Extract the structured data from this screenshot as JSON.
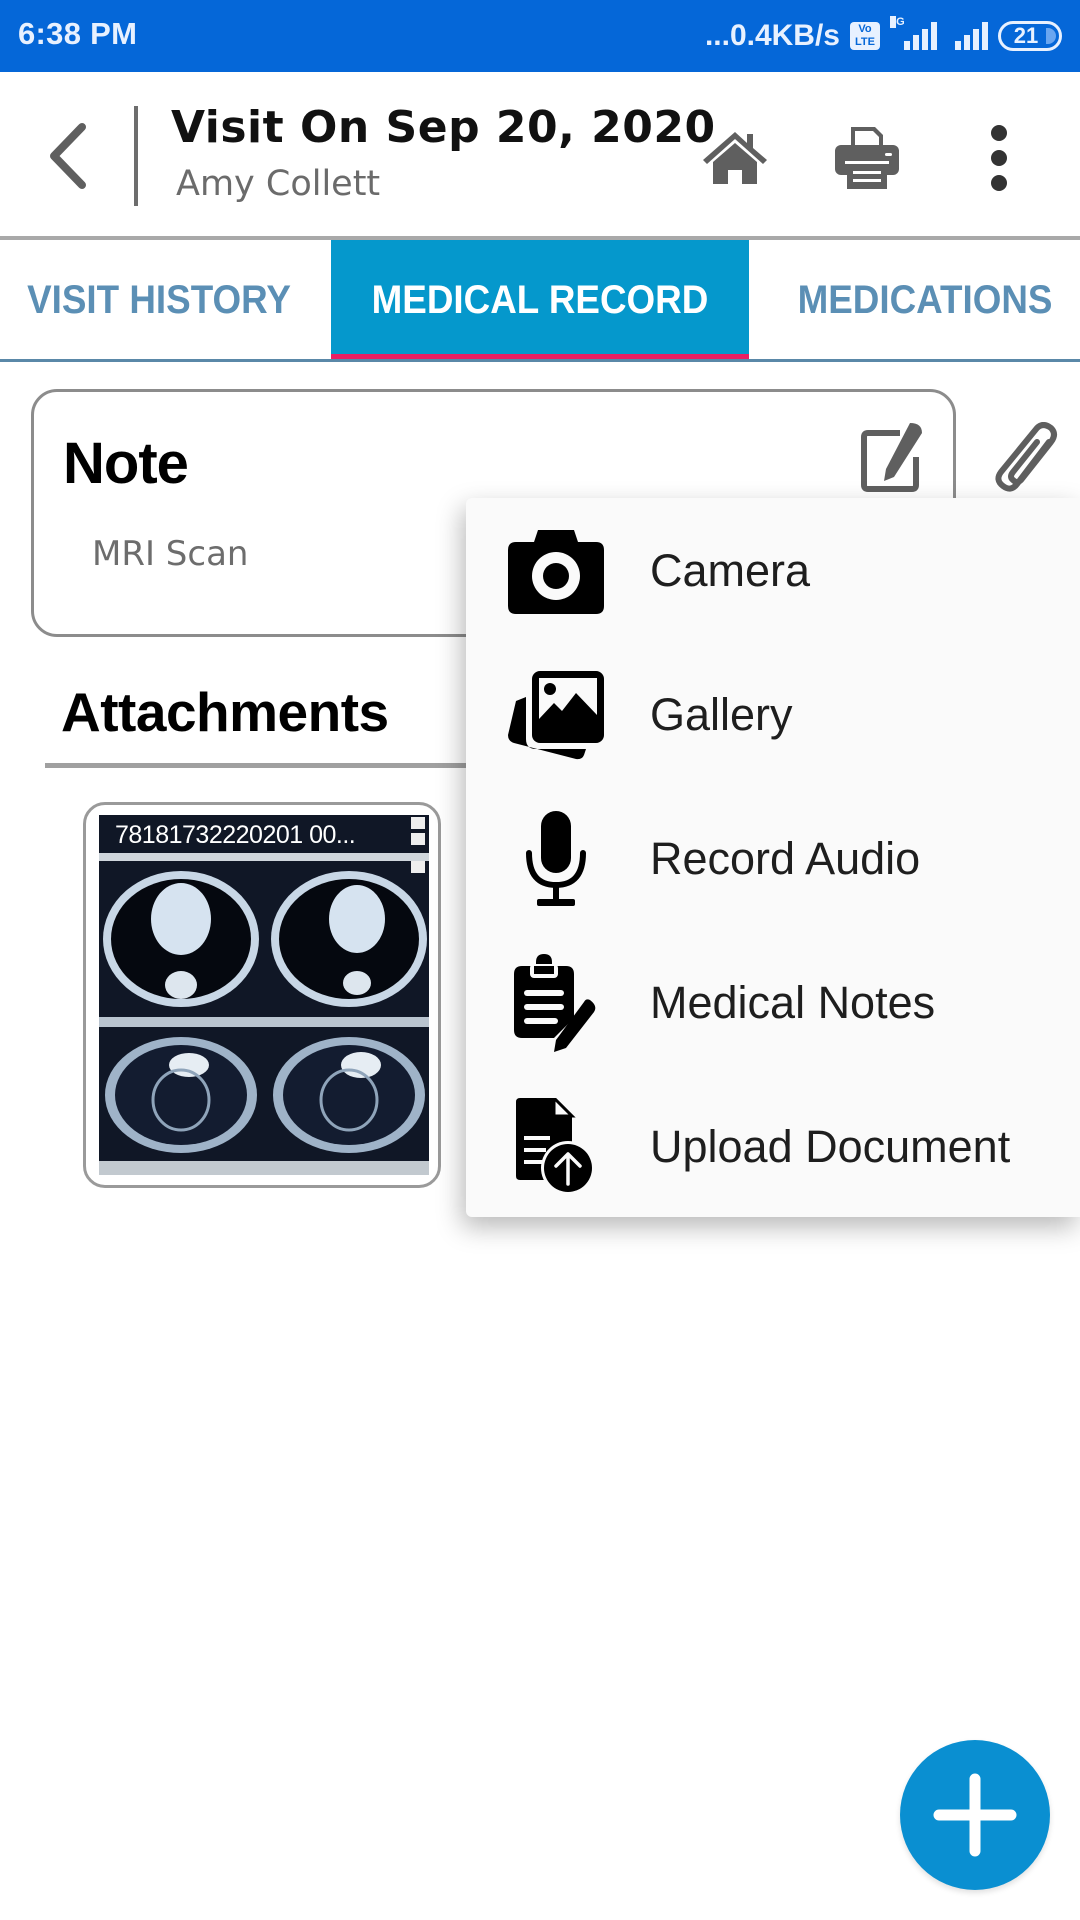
{
  "status_bar": {
    "time": "6:38 PM",
    "network_speed": "...0.4KB/s",
    "volte_badge": "Vo\nLTE",
    "network_type": "4G",
    "battery_level": "21"
  },
  "header": {
    "back_icon": "chevron-left-icon",
    "title": "Visit On Sep 20, 2020",
    "subtitle": "Amy Collett",
    "actions": [
      {
        "name": "home",
        "icon": "home-icon"
      },
      {
        "name": "print",
        "icon": "printer-icon"
      },
      {
        "name": "more",
        "icon": "more-vertical-icon"
      }
    ]
  },
  "tabs": [
    {
      "label": "VISIT HISTORY",
      "active": false
    },
    {
      "label": "MEDICAL RECORD",
      "active": true
    },
    {
      "label": "MEDICATIONS",
      "active": false
    }
  ],
  "note": {
    "title": "Note",
    "body": "MRI Scan",
    "edit_icon": "edit-icon",
    "attach_icon": "paperclip-icon"
  },
  "attachments": {
    "title": "Attachments",
    "items": [
      {
        "caption": "78181732220201 00...",
        "type": "image"
      }
    ]
  },
  "attach_menu": {
    "items": [
      {
        "label": "Camera",
        "icon": "camera-icon"
      },
      {
        "label": "Gallery",
        "icon": "gallery-icon"
      },
      {
        "label": "Record Audio",
        "icon": "microphone-icon"
      },
      {
        "label": "Medical Notes",
        "icon": "clipboard-edit-icon"
      },
      {
        "label": "Upload Document",
        "icon": "document-upload-icon"
      }
    ]
  },
  "fab": {
    "icon": "plus-icon"
  },
  "colors": {
    "status_bar": "#0567d8",
    "active_tab": "#0598cc",
    "tab_text": "#5b8fb5",
    "tab_indicator": "#e91e63",
    "fab": "#0a8fd1"
  }
}
